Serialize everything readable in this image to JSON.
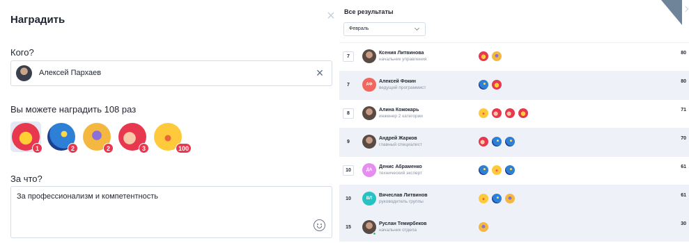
{
  "award": {
    "title": "Наградить",
    "who_label": "Кого?",
    "recipient": "Алексей Пархаев",
    "can_award": "Вы можете наградить 108 раз",
    "badges": [
      {
        "icon": "star-award-icon",
        "count": "1"
      },
      {
        "icon": "rocket-award-icon",
        "count": "2"
      },
      {
        "icon": "microphone-award-icon",
        "count": "2"
      },
      {
        "icon": "thumbs-up-award-icon",
        "count": "3"
      },
      {
        "icon": "smile-award-icon",
        "count": "100"
      }
    ],
    "why_label": "За что?",
    "reason": "За профессионализм и компетентность"
  },
  "results": {
    "title": "Все результаты",
    "month": "Февраль",
    "rows": [
      {
        "rank": "7",
        "initials": "",
        "avatar_color": "",
        "name": "Ксения Литвинова",
        "role": "начальник управления",
        "score": "80",
        "icons": [
          "star-award-icon",
          "microphone-award-icon"
        ]
      },
      {
        "rank": "7",
        "initials": "АФ",
        "avatar_color": "#f2665e",
        "name": "Алексей Фокин",
        "role": "ведущий программист",
        "score": "80",
        "icons": [
          "rocket-award-icon",
          "star-award-icon"
        ]
      },
      {
        "rank": "8",
        "initials": "",
        "avatar_color": "",
        "name": "Алина Кожокарь",
        "role": "инженер 2 категории",
        "score": "71",
        "icons": [
          "smile-award-icon",
          "thumbs-up-award-icon",
          "thumbs-up-award-icon",
          "star-award-icon"
        ]
      },
      {
        "rank": "9",
        "initials": "",
        "avatar_color": "",
        "name": "Андрей Жарков",
        "role": "главный специалист",
        "score": "70",
        "icons": [
          "thumbs-up-award-icon",
          "rocket-award-icon",
          "rocket-award-icon"
        ]
      },
      {
        "rank": "10",
        "initials": "ДА",
        "avatar_color": "#e48ef0",
        "name": "Денис Абраменко",
        "role": "технический эксперт",
        "score": "61",
        "icons": [
          "rocket-award-icon",
          "smile-award-icon",
          "rocket-award-icon"
        ]
      },
      {
        "rank": "10",
        "initials": "ВЛ",
        "avatar_color": "#27c2c4",
        "name": "Вячеслав Литвинов",
        "role": "руководитель группы",
        "score": "61",
        "icons": [
          "smile-award-icon",
          "rocket-award-icon",
          "microphone-award-icon"
        ]
      },
      {
        "rank": "15",
        "initials": "",
        "avatar_color": "",
        "name": "Руслан Темирбеков",
        "role": "начальник отдела",
        "score": "30",
        "icons": [
          "microphone-award-icon"
        ]
      }
    ]
  },
  "colors": {
    "accent_red": "#e8384f",
    "border": "#d7dde6",
    "row_alt": "#eef1f7",
    "online": "#3cc36f"
  }
}
